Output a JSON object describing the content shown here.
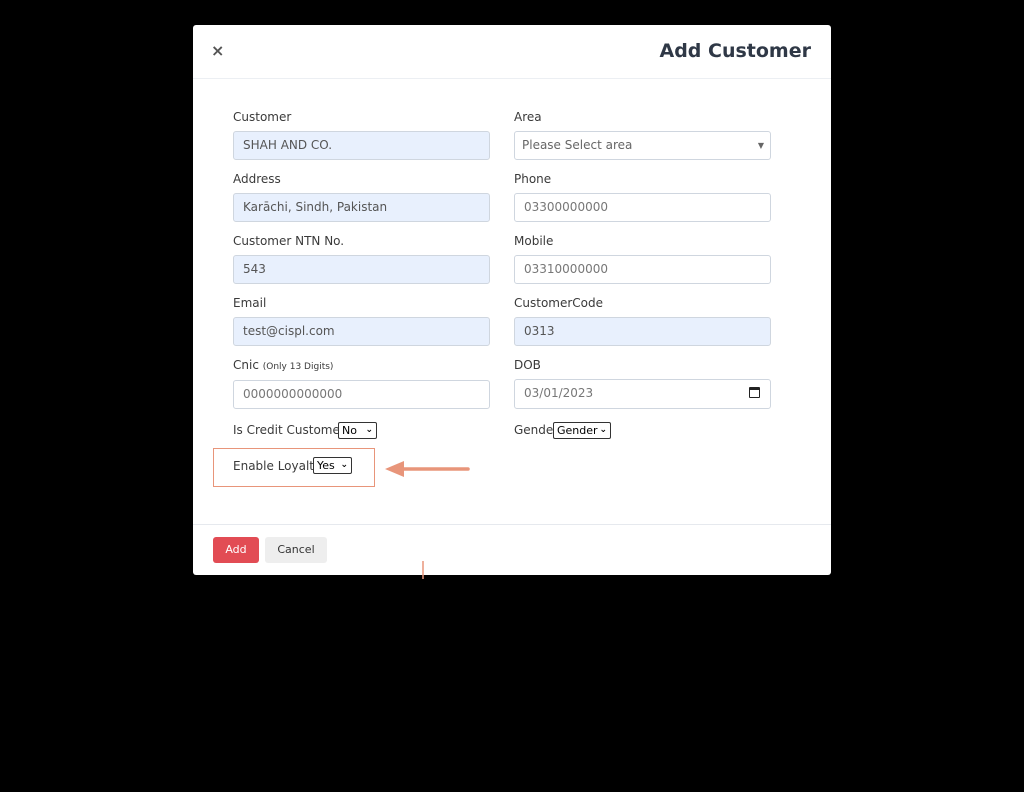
{
  "modal": {
    "title": "Add Customer",
    "close_symbol": "×"
  },
  "form": {
    "customer": {
      "label": "Customer",
      "value": "SHAH AND CO."
    },
    "area": {
      "label": "Area",
      "placeholder": "Please Select area"
    },
    "address": {
      "label": "Address",
      "value": "Karāchi, Sindh, Pakistan"
    },
    "phone": {
      "label": "Phone",
      "value": "03300000000"
    },
    "ntn": {
      "label": "Customer NTN No.",
      "value": "543"
    },
    "mobile": {
      "label": "Mobile",
      "value": "03310000000"
    },
    "email": {
      "label": "Email",
      "value": "test@cispl.com"
    },
    "customer_code": {
      "label": "CustomerCode",
      "value": "0313"
    },
    "cnic": {
      "label": "Cnic",
      "hint": "(Only 13 Digits)",
      "value": "0000000000000"
    },
    "dob": {
      "label": "DOB",
      "value": "03/01/2023"
    },
    "credit_customer": {
      "label": "Is Credit Customer?",
      "selected": "No"
    },
    "gender": {
      "label": "Gender",
      "selected": "Gender"
    },
    "loyalty": {
      "label": "Enable Loyalty",
      "selected": "Yes"
    }
  },
  "footer": {
    "add_label": "Add",
    "cancel_label": "Cancel"
  },
  "colors": {
    "backdrop": "#000000",
    "primary_button": "#e24c54",
    "autofill_bg": "#e8f0fd",
    "annotation": "#e8957a"
  },
  "icons": {
    "close": "close-icon",
    "dropdown": "chevron-down-icon",
    "calendar": "calendar-icon",
    "annotation_arrow": "arrow-left-icon"
  }
}
